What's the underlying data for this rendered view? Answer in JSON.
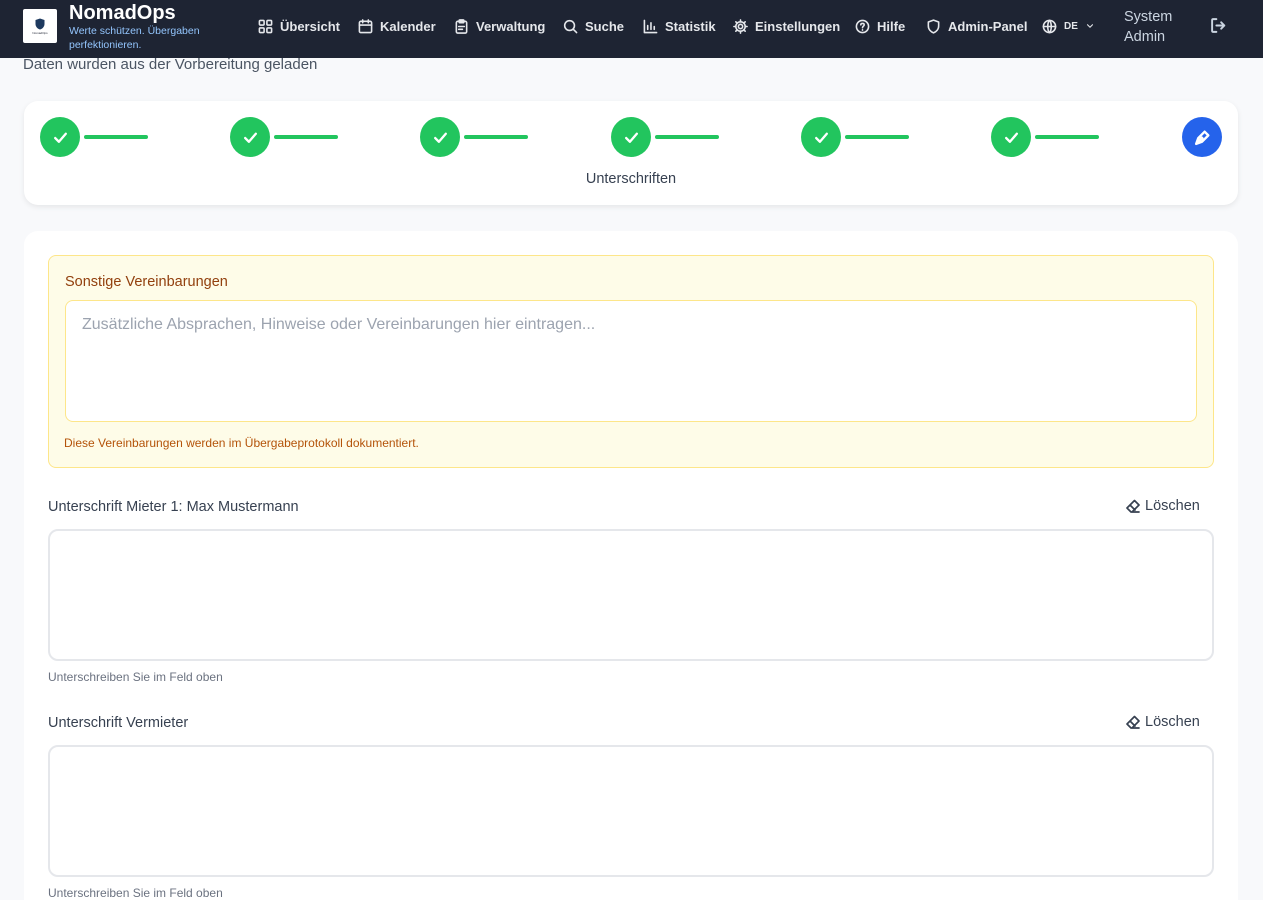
{
  "brand": {
    "name": "NomadOps",
    "tagline": "Werte schützen. Übergaben perfektionieren.",
    "logo_text": "NomadOps"
  },
  "nav": {
    "items": [
      {
        "label": "Übersicht",
        "icon": "grid-icon"
      },
      {
        "label": "Kalender",
        "icon": "calendar-icon"
      },
      {
        "label": "Verwaltung",
        "icon": "clipboard-icon"
      },
      {
        "label": "Suche",
        "icon": "search-icon"
      },
      {
        "label": "Statistik",
        "icon": "bar-chart-icon"
      },
      {
        "label": "Einstellungen",
        "icon": "gear-icon"
      },
      {
        "label": "Hilfe",
        "icon": "help-circle-icon"
      },
      {
        "label": "Admin-Panel",
        "icon": "shield-icon"
      }
    ],
    "language": "DE",
    "user": "System Admin"
  },
  "status_text": "Daten wurden aus der Vorbereitung geladen",
  "stepper": {
    "completed_steps": 6,
    "current_step": 7,
    "total_steps": 7,
    "current_label": "Unterschriften"
  },
  "agreements": {
    "title": "Sonstige Vereinbarungen",
    "placeholder": "Zusätzliche Absprachen, Hinweise oder Vereinbarungen hier eintragen...",
    "value": "",
    "note": "Diese Vereinbarungen werden im Übergabeprotokoll dokumentiert."
  },
  "signatures": {
    "tenant": {
      "label": "Unterschrift Mieter 1: Max Mustermann",
      "clear_label": "Löschen",
      "hint": "Unterschreiben Sie im Feld oben"
    },
    "landlord": {
      "label": "Unterschrift Vermieter",
      "clear_label": "Löschen",
      "hint": "Unterschreiben Sie im Feld oben"
    }
  },
  "colors": {
    "nav_bg": "#1e2433",
    "step_done": "#22c55e",
    "step_active": "#2563eb",
    "agree_bg": "#fefce8"
  }
}
